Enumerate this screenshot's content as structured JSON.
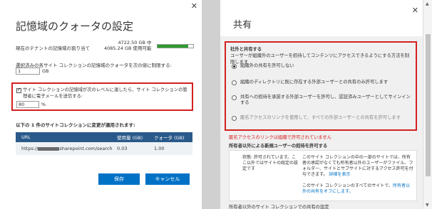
{
  "left": {
    "title": "記憶域のクォータの設定",
    "close": "✕",
    "quota_label": "現在のテナントの記憶域の割り当て",
    "quota_used": "4722.50 GB 中",
    "quota_free": "4085.24 GB 使用可能",
    "quota_fraction": 0.86,
    "limit_label": "選択済みの各サイト コレクションの記憶域のクォータを次の値に制限する:",
    "limit_value": "1",
    "limit_unit": "GB",
    "warn_text": "サイト コレクションの記憶域が次のレベルに達したら、サイト コレクションの管理者に電子メールを送信する:",
    "warn_value": "80",
    "warn_unit": "%",
    "applies_text": "以下の 1 件のサイトコレクションに変更が適用されます:",
    "table": {
      "headers": [
        "URL",
        "使用量 (GB)",
        "クォータ (GB)"
      ],
      "rows": [
        {
          "url_prefix": "https://",
          "url_suffix": "sharepoint.com/search",
          "usage": "0.03",
          "quota": "1.00"
        }
      ]
    },
    "save_label": "保存",
    "cancel_label": "キャンセル"
  },
  "right": {
    "title": "共有",
    "close": "✕",
    "share_title": "社外と共有する",
    "share_desc": "ユーザーが組織外のユーザーを招待してコンテンツにアクセスできるようにする方法を制限します",
    "options": [
      {
        "label": "組織外の共有を許可しない",
        "selected": true
      },
      {
        "label": "組織のディレクトリに既に存在する外部ユーザーとの共有のみ許可します",
        "selected": false
      },
      {
        "label": "共有への招待を承諾する外部ユーザーを許可し、認証済みユーザーとしてサインインする",
        "selected": false
      },
      {
        "label": "匿名アクセスのリンクを使用して、すべての外部ユーザーとの共有を許可します",
        "selected": false
      }
    ],
    "notice": "匿名アクセスのリンクは組織で許可されていません",
    "sec2_title": "所有者以外による新規ユーザーの招待を許可する",
    "status_text": "状態: 許可されています。ここ以外ではサイトの既定の設定です",
    "detail_text": "このサイト コレクションの中の一部のサイトでは、所有者の承認がなくても所有者以外のユーザーがファイル、フォルダー、サイトとサブサイトに対するアクセス許可を付与できます。",
    "detail_link": "詳細を表示",
    "detail2_text": "このサイト コレクションのすべてのサイトで、",
    "detail2_link": "所有者以外の共有をオフにします。",
    "bottom_cut": "所有者以外のサイト コレクションでの共有の設定"
  }
}
